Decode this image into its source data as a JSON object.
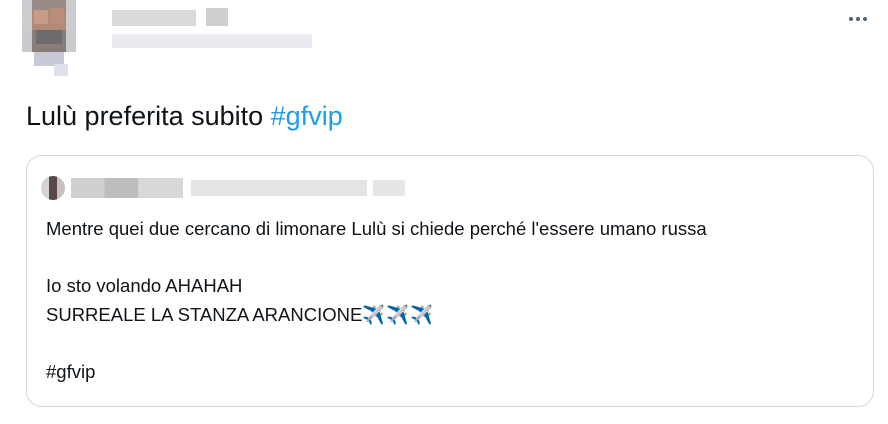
{
  "tweet": {
    "text": "Lulù preferita subito ",
    "hashtag": "#gfvip"
  },
  "more_icon": "more-horizontal-icon",
  "quote": {
    "lines": [
      "Mentre quei due cercano di limonare Lulù si chiede perché l'essere umano russa",
      "Io sto volando AHAHAH",
      "SURREALE LA STANZA ARANCIONE",
      "#gfvip"
    ],
    "emoji": "✈️✈️✈️"
  },
  "colors": {
    "accent": "#1d9bf0",
    "text": "#0f1419",
    "border": "#cfd9de",
    "muted": "#536471"
  }
}
